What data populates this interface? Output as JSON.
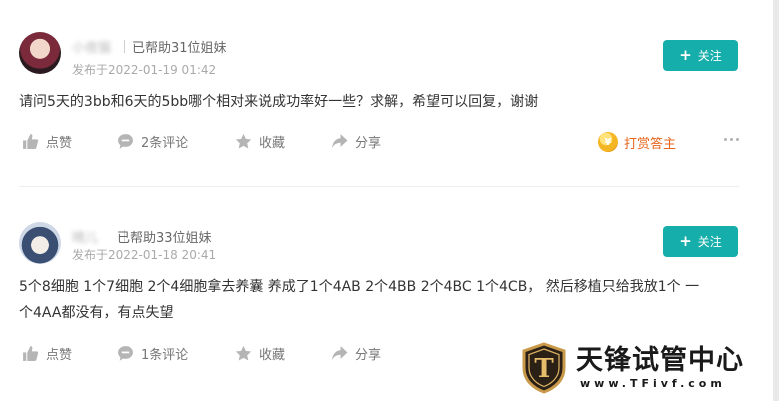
{
  "posts": [
    {
      "user_name": "小夜猫",
      "helped": "已帮助31位姐妹",
      "time": "发布于2022-01-19 01:42",
      "follow_label": "关注",
      "content": "请问5天的3bb和6天的5bb哪个相对来说成功率好一些？求解，希望可以回复，谢谢",
      "actions": {
        "like": "点赞",
        "comment": "2条评论",
        "favorite": "收藏",
        "share": "分享"
      },
      "reward": "打赏答主"
    },
    {
      "user_name": "晴儿",
      "helped": "已帮助33位姐妹",
      "time": "发布于2022-01-18 20:41",
      "follow_label": "关注",
      "content_line1": "5个8细胞 1个7细胞 2个4细胞拿去养囊 养成了1个4AB 2个4BB 2个4BC 1个4CB， 然后移植只给我放1个 一",
      "content_line2": "个4AA都没有，有点失望",
      "actions": {
        "like": "点赞",
        "comment": "1条评论",
        "favorite": "收藏",
        "share": "分享"
      }
    }
  ],
  "watermark": {
    "title": "天锋试管中心",
    "url": "www.TFivf.com",
    "logo_letter": "T"
  },
  "colors": {
    "accent": "#16aeaa",
    "reward": "#e8651c"
  }
}
